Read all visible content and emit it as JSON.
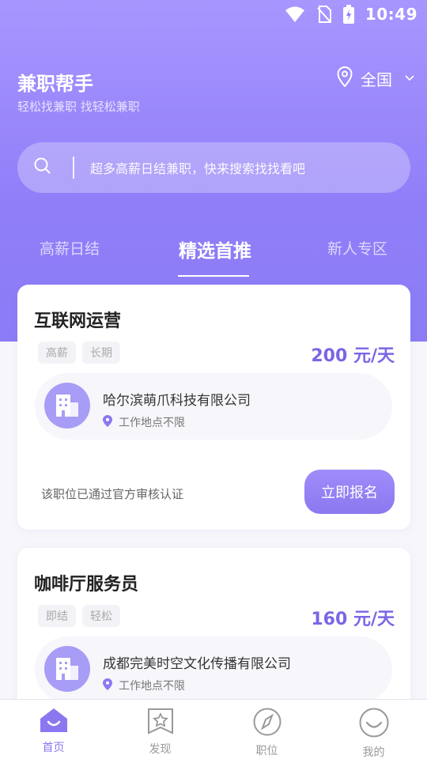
{
  "status_bar": {
    "time": "10:49"
  },
  "header": {
    "title": "兼职帮手",
    "subtitle": "轻松找兼职 找轻松兼职",
    "location": "全国"
  },
  "search": {
    "placeholder": "超多高薪日结兼职，快来搜索找找看吧"
  },
  "tabs": [
    {
      "label": "高薪日结",
      "active": false
    },
    {
      "label": "精选首推",
      "active": true
    },
    {
      "label": "新人专区",
      "active": false
    }
  ],
  "jobs": [
    {
      "title": "互联网运营",
      "tags": [
        "高薪",
        "长期"
      ],
      "salary": "200 元/天",
      "company": "哈尔滨萌爪科技有限公司",
      "location": "工作地点不限",
      "verify_text": "该职位已通过官方审核认证",
      "apply_label": "立即报名"
    },
    {
      "title": "咖啡厅服务员",
      "tags": [
        "即结",
        "轻松"
      ],
      "salary": "160 元/天",
      "company": "成都完美时空文化传播有限公司",
      "location": "工作地点不限"
    }
  ],
  "bottom_nav": [
    {
      "label": "首页",
      "icon": "home-icon",
      "active": true
    },
    {
      "label": "发现",
      "icon": "discover-icon",
      "active": false
    },
    {
      "label": "职位",
      "icon": "compass-icon",
      "active": false
    },
    {
      "label": "我的",
      "icon": "smile-icon",
      "active": false
    }
  ],
  "colors": {
    "accent": "#8b78f0",
    "hero_top": "#a896ff",
    "hero_bottom": "#8b7cf6",
    "salary": "#7a66e6"
  }
}
